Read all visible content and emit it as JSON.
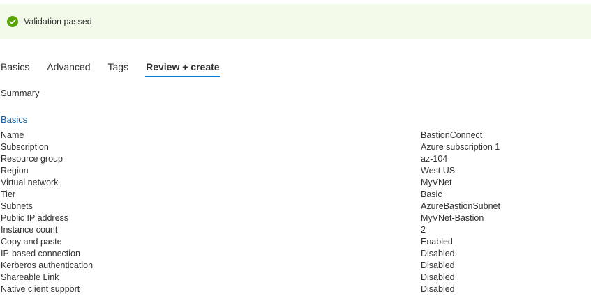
{
  "banner": {
    "message": "Validation passed",
    "icon": "check-circle-icon",
    "accent": "#57a300",
    "background": "#f2fbea"
  },
  "tabs": [
    {
      "label": "Basics",
      "active": false
    },
    {
      "label": "Advanced",
      "active": false
    },
    {
      "label": "Tags",
      "active": false
    },
    {
      "label": "Review + create",
      "active": true
    }
  ],
  "summary_label": "Summary",
  "section": {
    "title": "Basics",
    "rows": [
      {
        "key": "Name",
        "value": "BastionConnect"
      },
      {
        "key": "Subscription",
        "value": "Azure subscription 1"
      },
      {
        "key": "Resource group",
        "value": "az-104"
      },
      {
        "key": "Region",
        "value": "West US"
      },
      {
        "key": "Virtual network",
        "value": "MyVNet"
      },
      {
        "key": "Tier",
        "value": "Basic"
      },
      {
        "key": "Subnets",
        "value": "AzureBastionSubnet"
      },
      {
        "key": "Public IP address",
        "value": "MyVNet-Bastion"
      },
      {
        "key": "Instance count",
        "value": "2"
      },
      {
        "key": "Copy and paste",
        "value": "Enabled"
      },
      {
        "key": "IP-based connection",
        "value": "Disabled"
      },
      {
        "key": "Kerberos authentication",
        "value": "Disabled"
      },
      {
        "key": "Shareable Link",
        "value": "Disabled"
      },
      {
        "key": "Native client support",
        "value": "Disabled"
      }
    ]
  },
  "colors": {
    "tab_underline": "#0078d4",
    "section_title": "#0e5a9c",
    "text": "#323130"
  }
}
